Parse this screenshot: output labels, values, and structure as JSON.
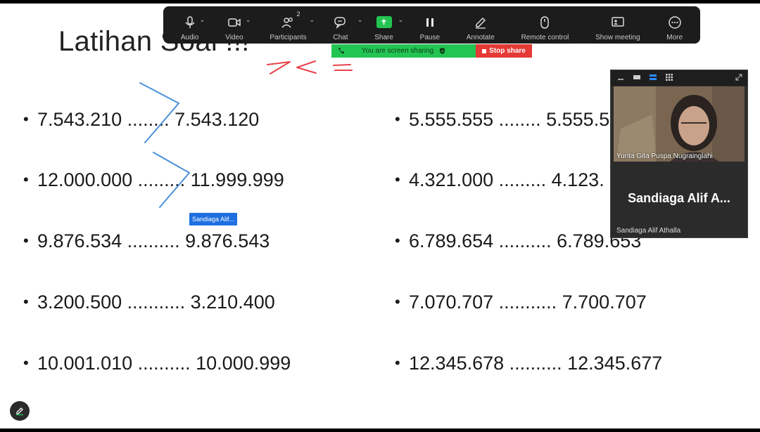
{
  "slide": {
    "title": "Latihan Soal !!!",
    "left_items": [
      "7.543.210 ........ 7.543.120",
      "12.000.000 ......... 11.999.999",
      "9.876.534 .......... 9.876.543",
      "3.200.500 ........... 3.210.400",
      "10.001.010 .......... 10.000.999"
    ],
    "right_items": [
      "5.555.555 ........ 5.555.5",
      "4.321.000 ......... 4.123.",
      "6.789.654 .......... 6.789.653",
      "7.070.707 ........... 7.700.707",
      "12.345.678 .......... 12.345.677"
    ],
    "bullet_char": "•",
    "annotation_tag": "Sandiaga Alif..."
  },
  "annotation_colors": {
    "red": "#e8424a",
    "blue": "#4a90d9"
  },
  "toolbar": {
    "items": [
      {
        "label": "Audio",
        "icon": "microphone-icon",
        "caret": true
      },
      {
        "label": "Video",
        "icon": "video-camera-icon",
        "caret": true
      },
      {
        "label": "Participants",
        "icon": "participants-icon",
        "caret": true,
        "count": "2"
      },
      {
        "label": "Chat",
        "icon": "chat-icon",
        "caret": true
      },
      {
        "label": "Share",
        "icon": "share-screen-icon",
        "caret": true
      },
      {
        "label": "Pause",
        "icon": "pause-icon",
        "caret": false
      },
      {
        "label": "Annotate",
        "icon": "pencil-icon",
        "caret": false
      },
      {
        "label": "Remote control",
        "icon": "mouse-icon",
        "caret": false
      },
      {
        "label": "Show meeting",
        "icon": "show-meeting-icon",
        "caret": false
      },
      {
        "label": "More",
        "icon": "more-icon",
        "caret": false
      }
    ],
    "caret_char": "⌄",
    "share_color": "#23c552"
  },
  "sharing": {
    "status_text": "You are screen sharing",
    "stop_label": "Stop share",
    "stop_color": "#e53935"
  },
  "video_panel": {
    "camera_name": "Yurita Gita Puspa Nugrainglahi",
    "tile_big_name": "Sandiaga Alif A...",
    "tile_small_name": "Sandiaga Alif Athalla"
  }
}
